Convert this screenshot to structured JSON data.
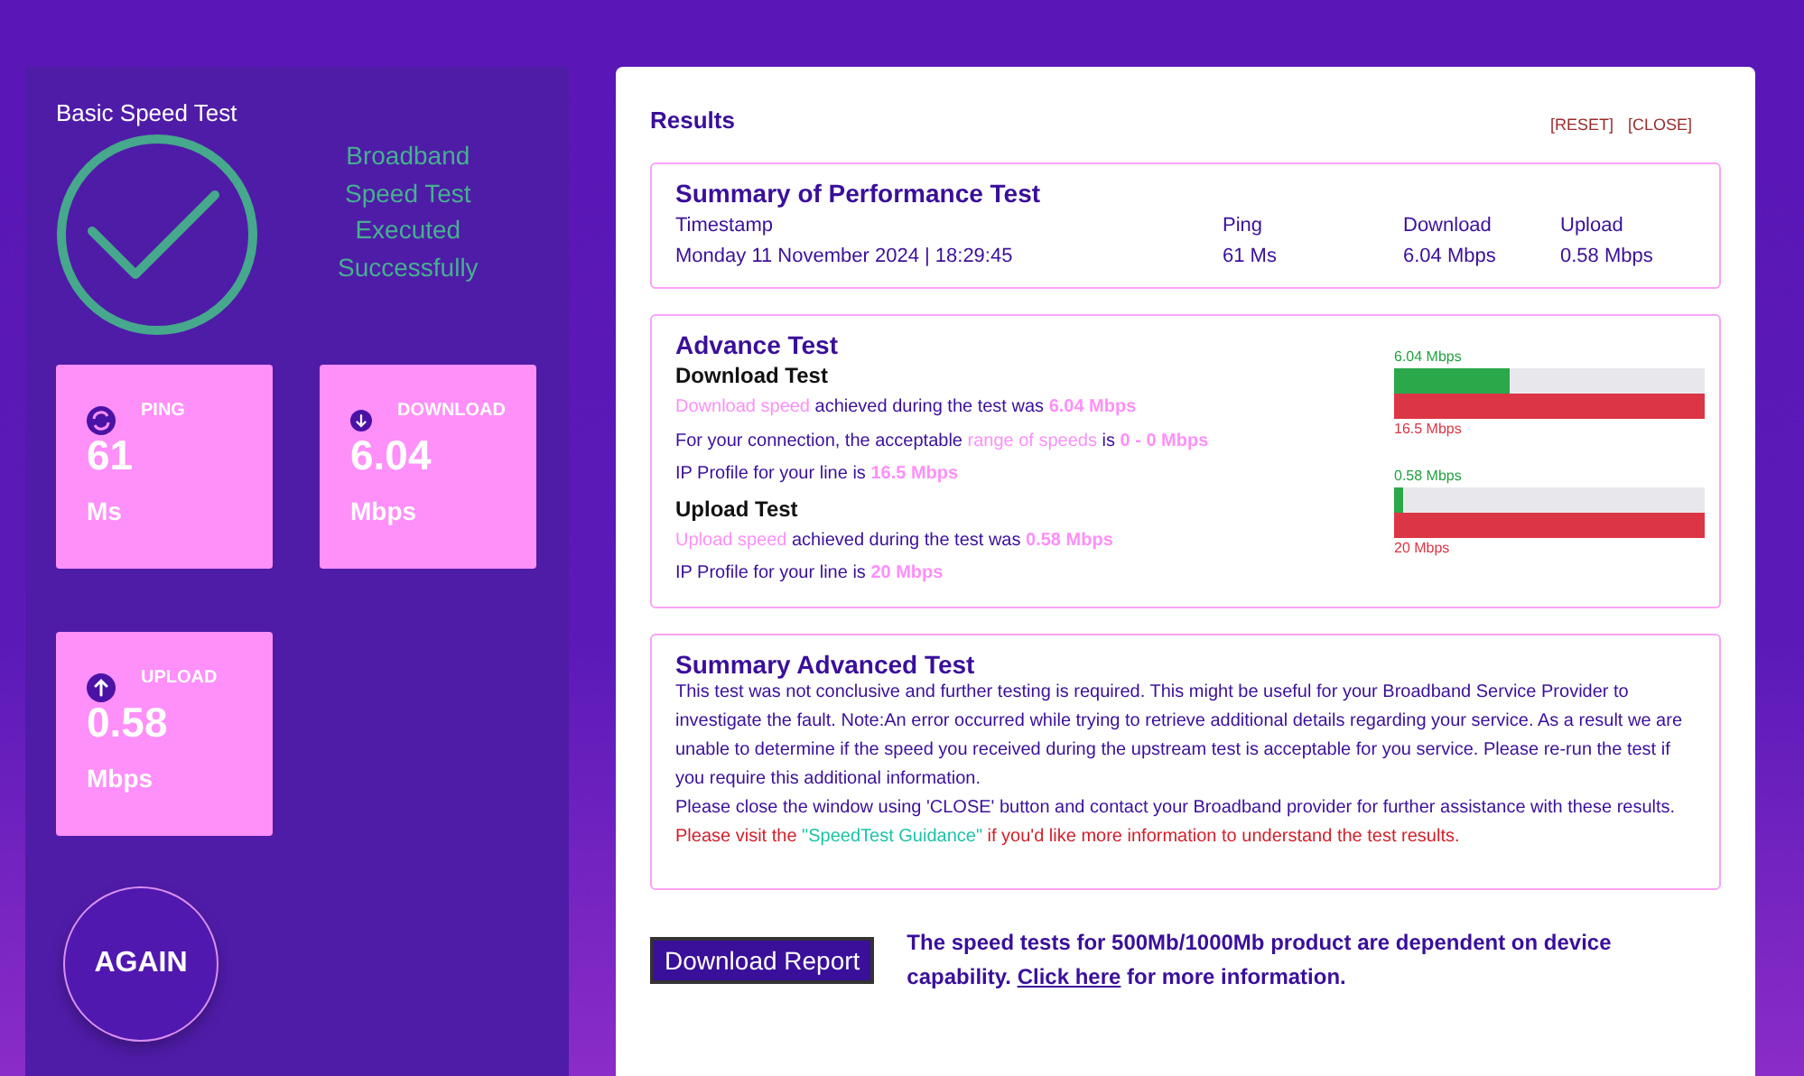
{
  "left_panel": {
    "title": "Basic Speed Test",
    "status_lines": [
      "Broadband",
      "Speed Test",
      "Executed",
      "Successfully"
    ],
    "tiles": [
      {
        "kind": "ping",
        "label": "PING",
        "value": "61",
        "unit": "Ms"
      },
      {
        "kind": "download",
        "label": "DOWNLOAD",
        "value": "6.04",
        "unit": "Mbps"
      },
      {
        "kind": "upload",
        "label": "UPLOAD",
        "value": "0.58",
        "unit": "Mbps"
      }
    ],
    "again_button": "AGAIN"
  },
  "results": {
    "title": "Results",
    "actions": [
      "[RESET]",
      "[CLOSE]"
    ],
    "summary": {
      "title": "Summary of Performance Test",
      "columns": [
        {
          "heading": "Timestamp",
          "value": "Monday 11 November 2024 | 18:29:45"
        },
        {
          "heading": "Ping",
          "value": "61 Ms"
        },
        {
          "heading": "Download",
          "value": "6.04 Mbps"
        },
        {
          "heading": "Upload",
          "value": "0.58 Mbps"
        }
      ]
    },
    "advance": {
      "title": "Advance Test",
      "tests": [
        {
          "title": "Download Test",
          "lines": [
            [
              {
                "kind": "highlight",
                "text": "Download speed"
              },
              {
                "kind": "plain",
                "text": " achieved during the test was "
              },
              {
                "kind": "value",
                "text": "6.04 Mbps"
              }
            ],
            [
              {
                "kind": "plain",
                "text": "For your connection, the acceptable "
              },
              {
                "kind": "highlight",
                "text": "range of speeds"
              },
              {
                "kind": "plain",
                "text": " is "
              },
              {
                "kind": "value",
                "text": "0 - 0 Mbps"
              }
            ],
            [
              {
                "kind": "plain",
                "text": "IP Profile for your line is "
              },
              {
                "kind": "value",
                "text": "16.5 Mbps"
              }
            ]
          ],
          "bar": {
            "measured_label": "6.04 Mbps",
            "level": 0.37,
            "profile_label": "16.5 Mbps"
          }
        },
        {
          "title": "Upload Test",
          "lines": [
            [
              {
                "kind": "highlight",
                "text": "Upload speed"
              },
              {
                "kind": "plain",
                "text": " achieved during the test was "
              },
              {
                "kind": "value",
                "text": "0.58 Mbps"
              }
            ],
            [
              {
                "kind": "plain",
                "text": "IP Profile for your line is "
              },
              {
                "kind": "value",
                "text": "20 Mbps"
              }
            ]
          ],
          "bar": {
            "measured_label": "0.58 Mbps",
            "level": 0.03,
            "profile_label": "20 Mbps"
          }
        }
      ]
    },
    "summary_advanced": {
      "title": "Summary Advanced Test",
      "paragraphs": [
        [
          {
            "kind": "plain",
            "text": "This test was not conclusive and further testing is required. This might be useful for your Broadband Service Provider to investigate the fault. Note:An error occurred while trying to retrieve additional details regarding your service. As a result we are unable to determine if the speed you received during the upstream test is acceptable for you service. Please re-run the test if you require this additional information."
          }
        ],
        [
          {
            "kind": "plain",
            "text": "Please close the window using 'CLOSE' button and contact your Broadband provider for further assistance with these results."
          }
        ],
        [
          {
            "kind": "warning",
            "text": "Please visit the "
          },
          {
            "kind": "link",
            "text": "\"SpeedTest Guidance\""
          },
          {
            "kind": "warning",
            "text": " if you'd like more information to understand the test results."
          }
        ]
      ]
    },
    "footer": {
      "button": "Download Report",
      "note": [
        {
          "kind": "plain",
          "text": "The speed tests for 500Mb/1000Mb product are dependent on device capability. "
        },
        {
          "kind": "link",
          "text": "Click here"
        },
        {
          "kind": "plain",
          "text": " for more information."
        }
      ]
    }
  }
}
